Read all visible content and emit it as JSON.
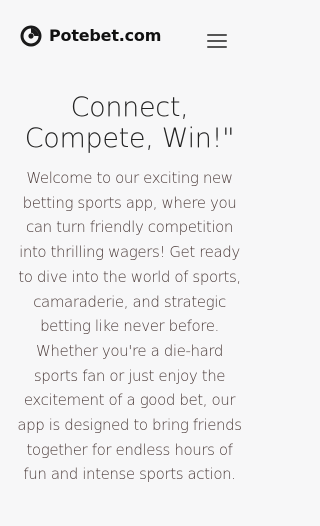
{
  "header": {
    "brand_name": "Potebet.com",
    "logo_icon": "potebet-logo-icon",
    "menu_icon": "hamburger-menu-icon"
  },
  "hero": {
    "title": "Connect, Compete, Win!\"",
    "description": "Welcome to our exciting new betting sports app, where you can turn friendly competition into thrilling wagers! Get ready to dive into the world of sports, camaraderie, and strategic betting like never before. Whether you're a die-hard sports fan or just enjoy the excitement of a good bet, our app is designed to bring friends together for endless hours of fun and intense sports action."
  },
  "colors": {
    "background": "#f7f7f8",
    "title": "#222222",
    "body_text": "#4a3a38",
    "brand_text": "#111111"
  }
}
